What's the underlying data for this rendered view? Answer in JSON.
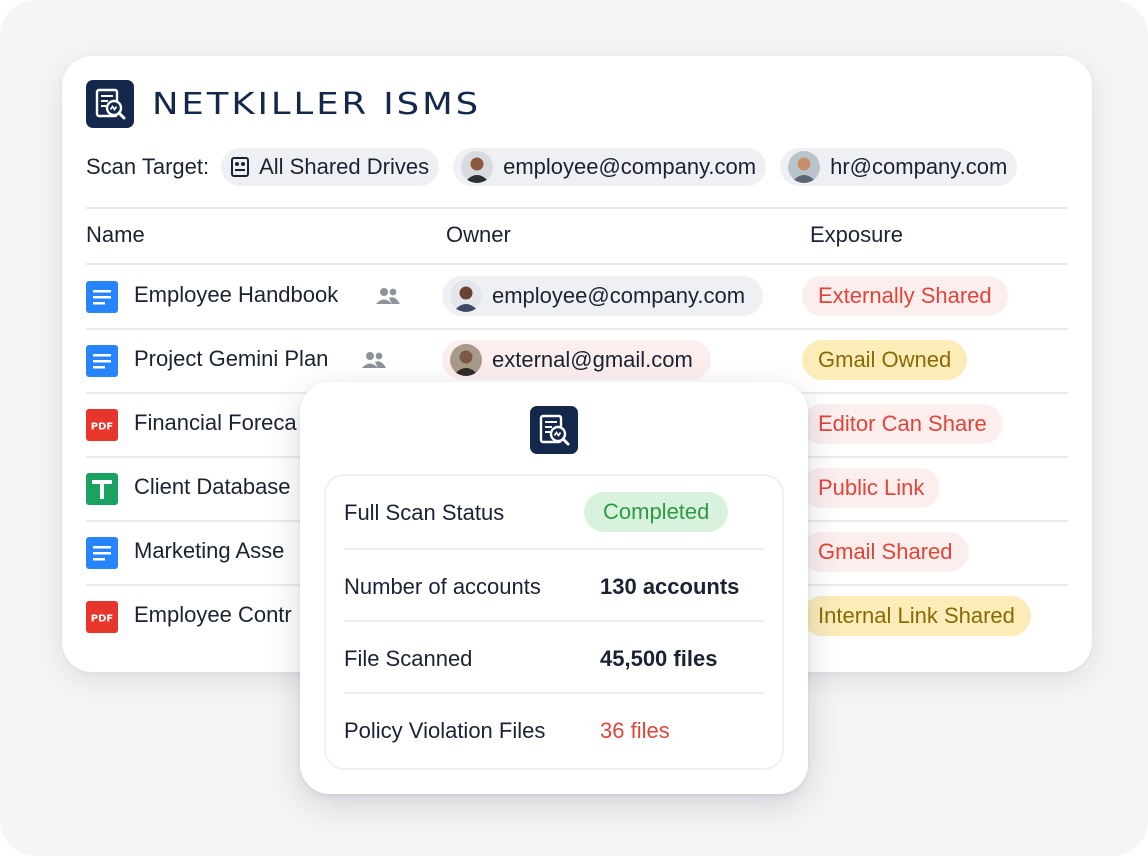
{
  "brand": {
    "name": "NETKILLER ISMS",
    "logo_icon": "netkiller-logo-icon",
    "color": "#14284b"
  },
  "scan_target": {
    "label": "Scan Target:",
    "targets": [
      {
        "label": "All Shared Drives",
        "icon": "shared-drive-icon"
      },
      {
        "label": "employee@company.com",
        "icon": "avatar"
      },
      {
        "label": "hr@company.com",
        "icon": "avatar"
      }
    ]
  },
  "table": {
    "headers": {
      "name": "Name",
      "owner": "Owner",
      "exposure": "Exposure"
    },
    "rows": [
      {
        "name": "Employee Handbook",
        "type": "doc",
        "shared": true,
        "owner": "employee@company.com",
        "exposure": "Externally Shared",
        "exposure_color": "#e0453a"
      },
      {
        "name": "Project Gemini Plan",
        "type": "doc",
        "shared": true,
        "owner": "external@gmail.com",
        "exposure": "Gmail Owned",
        "exposure_color": "#8a6a08"
      },
      {
        "name": "Financial Foreca",
        "type": "pdf",
        "shared": false,
        "owner": "",
        "exposure": "Editor Can Share",
        "exposure_color": "#e0453a"
      },
      {
        "name": "Client Database",
        "type": "sheet",
        "shared": false,
        "owner": "",
        "exposure": "Public Link",
        "exposure_color": "#e0453a"
      },
      {
        "name": "Marketing Asse",
        "type": "doc",
        "shared": false,
        "owner": "",
        "exposure": "Gmail Shared",
        "exposure_color": "#e0453a"
      },
      {
        "name": "Employee Contr",
        "type": "pdf",
        "shared": false,
        "owner": "",
        "exposure": "Internal Link Shared",
        "exposure_color": "#8a6a08"
      }
    ]
  },
  "scan_summary": {
    "logo_icon": "netkiller-logo-icon",
    "rows": [
      {
        "label": "Full Scan Status",
        "value": "Completed",
        "status_color": "#2f9a45"
      },
      {
        "label": "Number of accounts",
        "value": "130 accounts"
      },
      {
        "label": "File Scanned",
        "value": "45,500 files"
      },
      {
        "label": "Policy Violation Files",
        "value": "36 files",
        "value_color": "#e0453a"
      }
    ]
  },
  "pdf_icon_text": "PDF"
}
